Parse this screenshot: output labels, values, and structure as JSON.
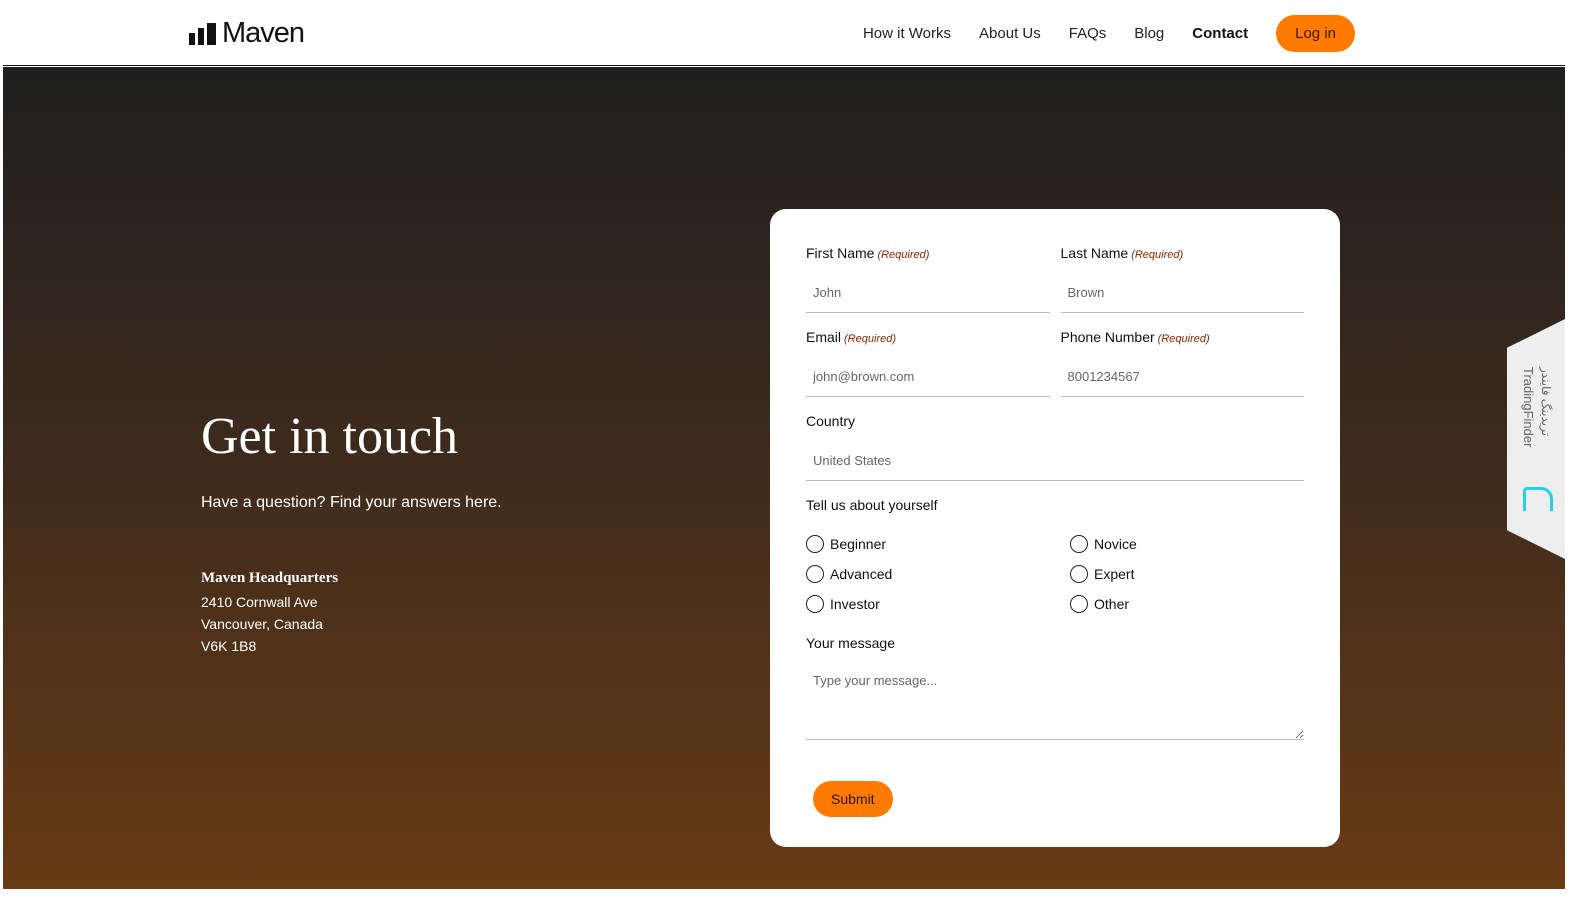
{
  "header": {
    "logo": "Maven",
    "nav": [
      {
        "label": "How it Works"
      },
      {
        "label": "About Us"
      },
      {
        "label": "FAQs"
      },
      {
        "label": "Blog"
      },
      {
        "label": "Contact",
        "active": true
      }
    ],
    "login": "Log in"
  },
  "hero": {
    "title": "Get in touch",
    "subtitle": "Have a question? Find your answers here.",
    "hq_name": "Maven Headquarters",
    "address": [
      "2410 Cornwall Ave",
      "Vancouver, Canada",
      "V6K 1B8"
    ]
  },
  "form": {
    "required": "(Required)",
    "first_name": {
      "label": "First Name",
      "placeholder": "John"
    },
    "last_name": {
      "label": "Last Name",
      "placeholder": "Brown"
    },
    "email": {
      "label": "Email",
      "placeholder": "john@brown.com"
    },
    "phone": {
      "label": "Phone Number",
      "placeholder": "8001234567"
    },
    "country": {
      "label": "Country",
      "placeholder": "United States"
    },
    "about_label": "Tell us about yourself",
    "options": [
      "Beginner",
      "Novice",
      "Advanced",
      "Expert",
      "Investor",
      "Other"
    ],
    "message": {
      "label": "Your message",
      "placeholder": "Type your message..."
    },
    "submit": "Submit"
  },
  "widget": {
    "latin": "TradingFinder",
    "arabic": "تریدینگ فایندر",
    "accent": "#22d3e6"
  },
  "colors": {
    "accent": "#ff7a00",
    "required": "#8b2500"
  }
}
